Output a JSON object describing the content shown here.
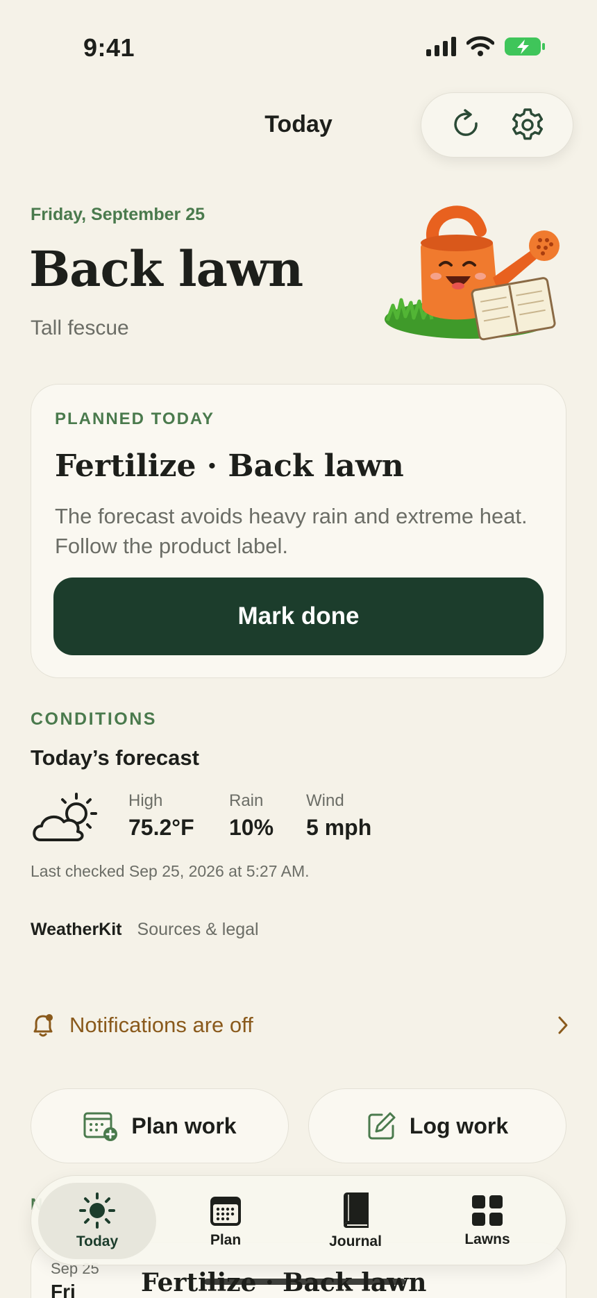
{
  "status": {
    "time": "9:41"
  },
  "nav": {
    "title": "Today"
  },
  "header": {
    "date": "Friday, September 25",
    "lawn_name": "Back lawn",
    "grass_type": "Tall fescue"
  },
  "planned": {
    "eyebrow": "PLANNED TODAY",
    "title": "Fertilize · Back lawn",
    "body": "The forecast avoids heavy rain and extreme heat. Follow the product label.",
    "button": "Mark done"
  },
  "conditions": {
    "eyebrow": "CONDITIONS",
    "title": "Today’s forecast",
    "metrics": [
      {
        "label": "High",
        "value": "75.2°F"
      },
      {
        "label": "Rain",
        "value": "10%"
      },
      {
        "label": "Wind",
        "value": "5 mph"
      }
    ],
    "last_checked": "Last checked Sep 25, 2026 at 5:27 AM.",
    "source": "WeatherKit",
    "legal": "Sources & legal"
  },
  "notifications": {
    "text": "Notifications are off"
  },
  "actions": {
    "plan": "Plan work",
    "log": "Log work"
  },
  "peek": {
    "heading": "N",
    "date": "Sep 25",
    "day": "Fri",
    "title": "Fertilize · Back lawn"
  },
  "tabs": [
    {
      "label": "Today"
    },
    {
      "label": "Plan"
    },
    {
      "label": "Journal"
    },
    {
      "label": "Lawns"
    }
  ],
  "colors": {
    "accent": "#1c3d2c",
    "eyebrow": "#4a7a4d",
    "warning": "#8a5a1c",
    "background": "#f5f2e8"
  }
}
